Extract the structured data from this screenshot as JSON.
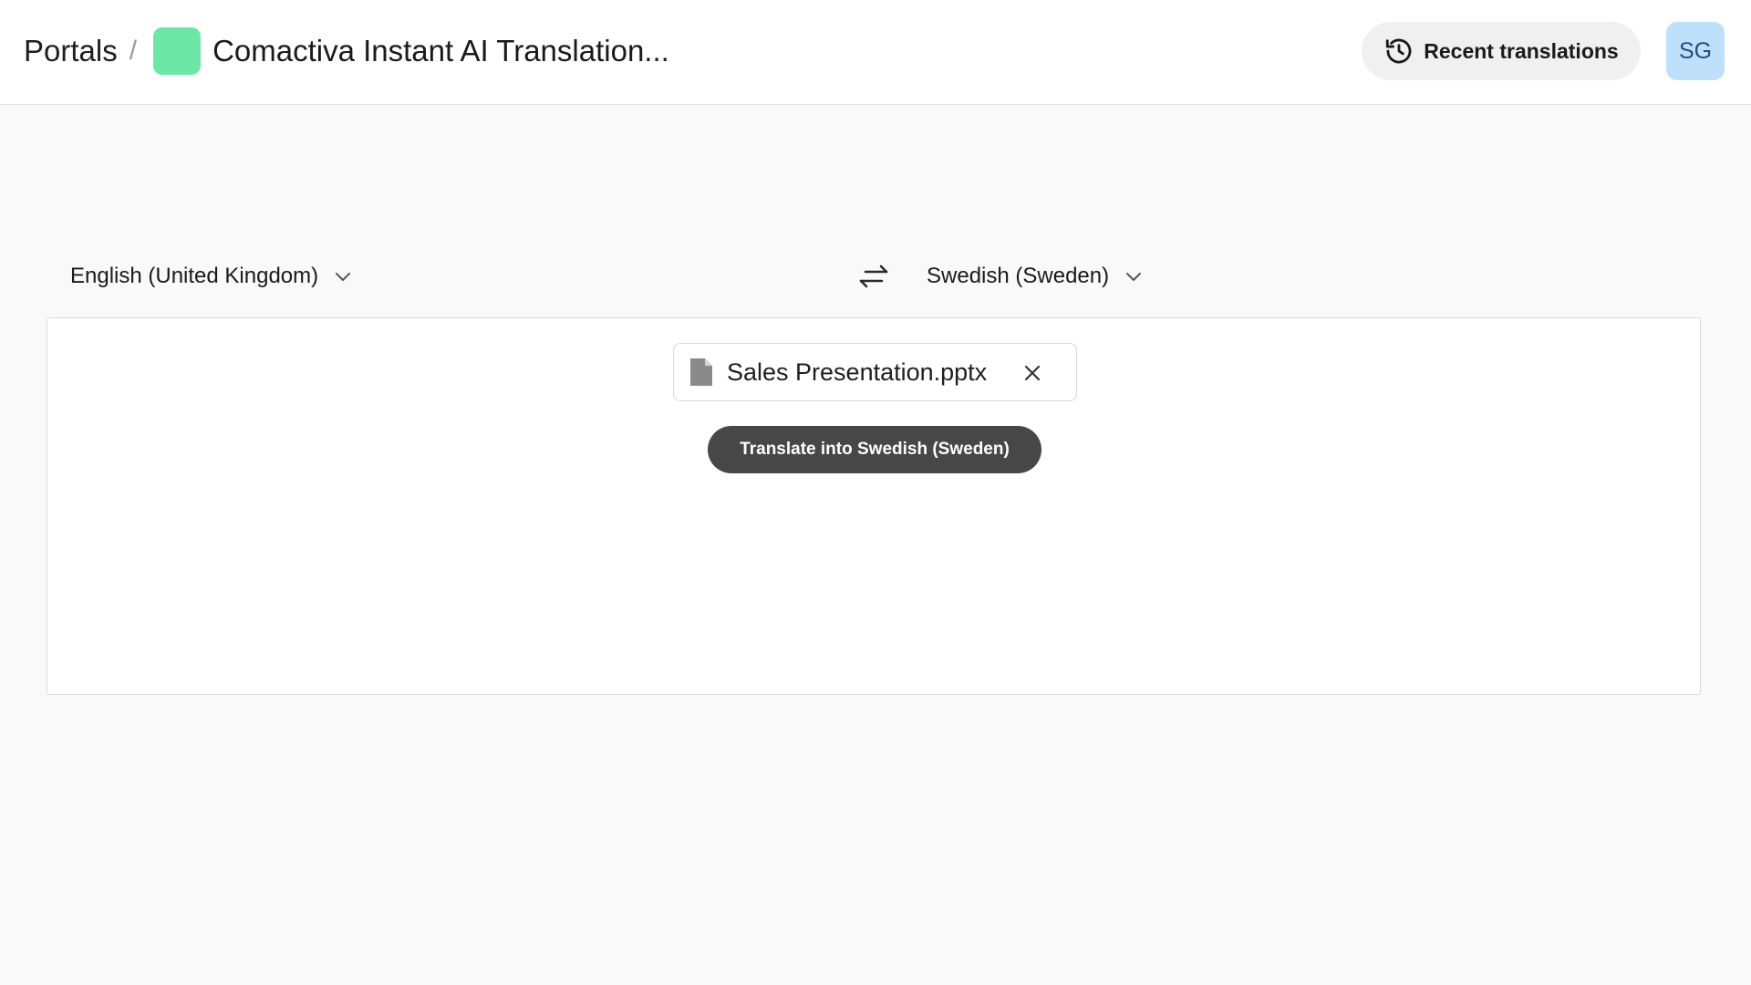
{
  "header": {
    "breadcrumb_root": "Portals",
    "separator": "/",
    "title": "Comactiva Instant AI Translation...",
    "portal_color": "#6ee7a6"
  },
  "recent": {
    "label": "Recent translations",
    "icon": "history-icon"
  },
  "user": {
    "initials": "SG",
    "avatar_bg": "#bfe0fb"
  },
  "languages": {
    "source": "English (United Kingdom)",
    "target": "Swedish (Sweden)",
    "swap_icon": "swap-arrows-icon"
  },
  "file": {
    "name": "Sales Presentation.pptx",
    "icon": "document-icon",
    "remove_icon": "close-icon"
  },
  "action": {
    "translate_label": "Translate into Swedish (Sweden)",
    "button_color": "#474747"
  }
}
